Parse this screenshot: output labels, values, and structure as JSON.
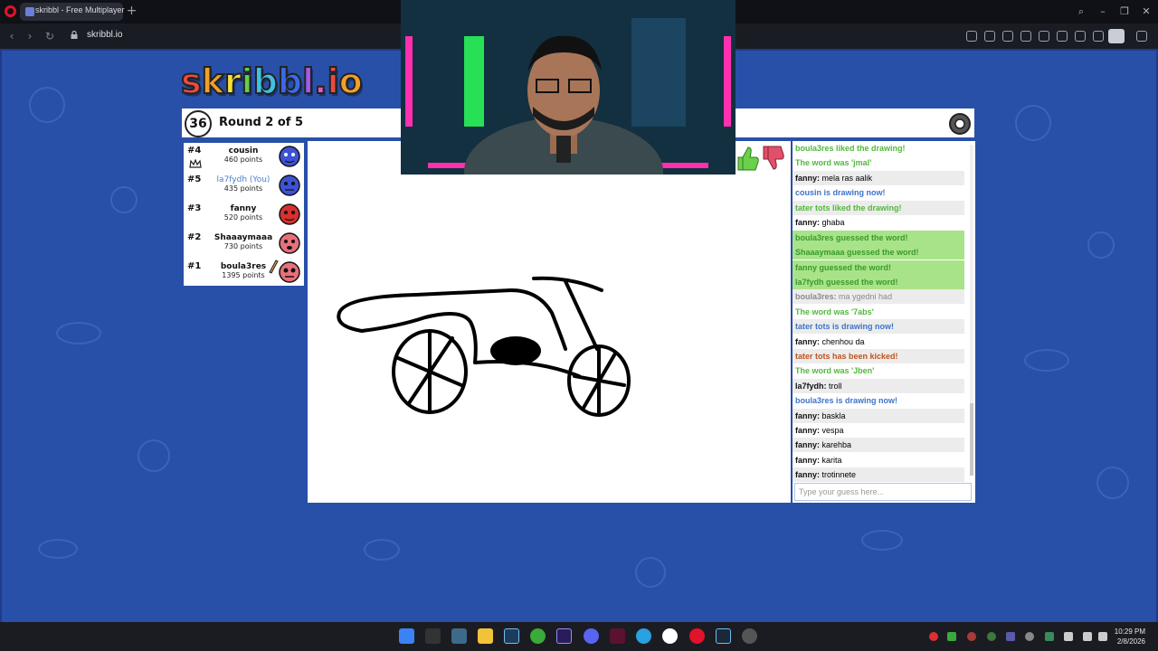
{
  "browser": {
    "tab_title": "skribbl - Free Multiplayer",
    "url": "skribbl.io"
  },
  "game": {
    "logo_text": "skribbl.io",
    "timer": "36",
    "round_text": "Round 2 of 5",
    "players": [
      {
        "rank": "#4",
        "name": "cousin",
        "points": "460 points",
        "color": "#3d53d6"
      },
      {
        "rank": "#5",
        "name": "la7fydh (You)",
        "points": "435 points",
        "color": "#3d53d6"
      },
      {
        "rank": "#3",
        "name": "fanny",
        "points": "520 points",
        "color": "#d63030"
      },
      {
        "rank": "#2",
        "name": "Shaaaymaaa",
        "points": "730 points",
        "color": "#e8707a"
      },
      {
        "rank": "#1",
        "name": "boula3res",
        "points": "1395 points",
        "color": "#e8707a"
      }
    ],
    "chat": [
      {
        "type": "green",
        "text": "boula3res liked the drawing!"
      },
      {
        "type": "green",
        "text": "The word was 'jmal'"
      },
      {
        "type": "msg",
        "who": "fanny:",
        "text": "mela ras aalik"
      },
      {
        "type": "blue",
        "text": "cousin is drawing now!"
      },
      {
        "type": "green",
        "text": "tater tots liked the drawing!"
      },
      {
        "type": "msg",
        "who": "fanny:",
        "text": "ghaba"
      },
      {
        "type": "greenbg",
        "text": "boula3res guessed the word!"
      },
      {
        "type": "greenbg",
        "text": "Shaaaymaaa guessed the word!"
      },
      {
        "type": "greenbg",
        "text": "fanny guessed the word!"
      },
      {
        "type": "greenbg",
        "text": "la7fydh guessed the word!"
      },
      {
        "type": "gray",
        "who": "boula3res:",
        "text": "ma ygedni had"
      },
      {
        "type": "green",
        "text": "The word was '7abs'"
      },
      {
        "type": "blue",
        "text": "tater tots is drawing now!"
      },
      {
        "type": "msg",
        "who": "fanny:",
        "text": "chenhou da"
      },
      {
        "type": "red",
        "text": "tater tots has been kicked!"
      },
      {
        "type": "green",
        "text": "The word was 'Jben'"
      },
      {
        "type": "msg",
        "who": "la7fydh:",
        "text": "troll"
      },
      {
        "type": "blue",
        "text": "boula3res is drawing now!"
      },
      {
        "type": "msg",
        "who": "fanny:",
        "text": "baskla"
      },
      {
        "type": "msg",
        "who": "fanny:",
        "text": "vespa"
      },
      {
        "type": "msg",
        "who": "fanny:",
        "text": "karehba"
      },
      {
        "type": "msg",
        "who": "fanny:",
        "text": "karita"
      },
      {
        "type": "msg",
        "who": "fanny:",
        "text": "trotinnete"
      }
    ],
    "guess_placeholder": "Type your guess here..."
  },
  "taskbar": {
    "time": "10:29 PM",
    "date": "2/8/2026"
  }
}
